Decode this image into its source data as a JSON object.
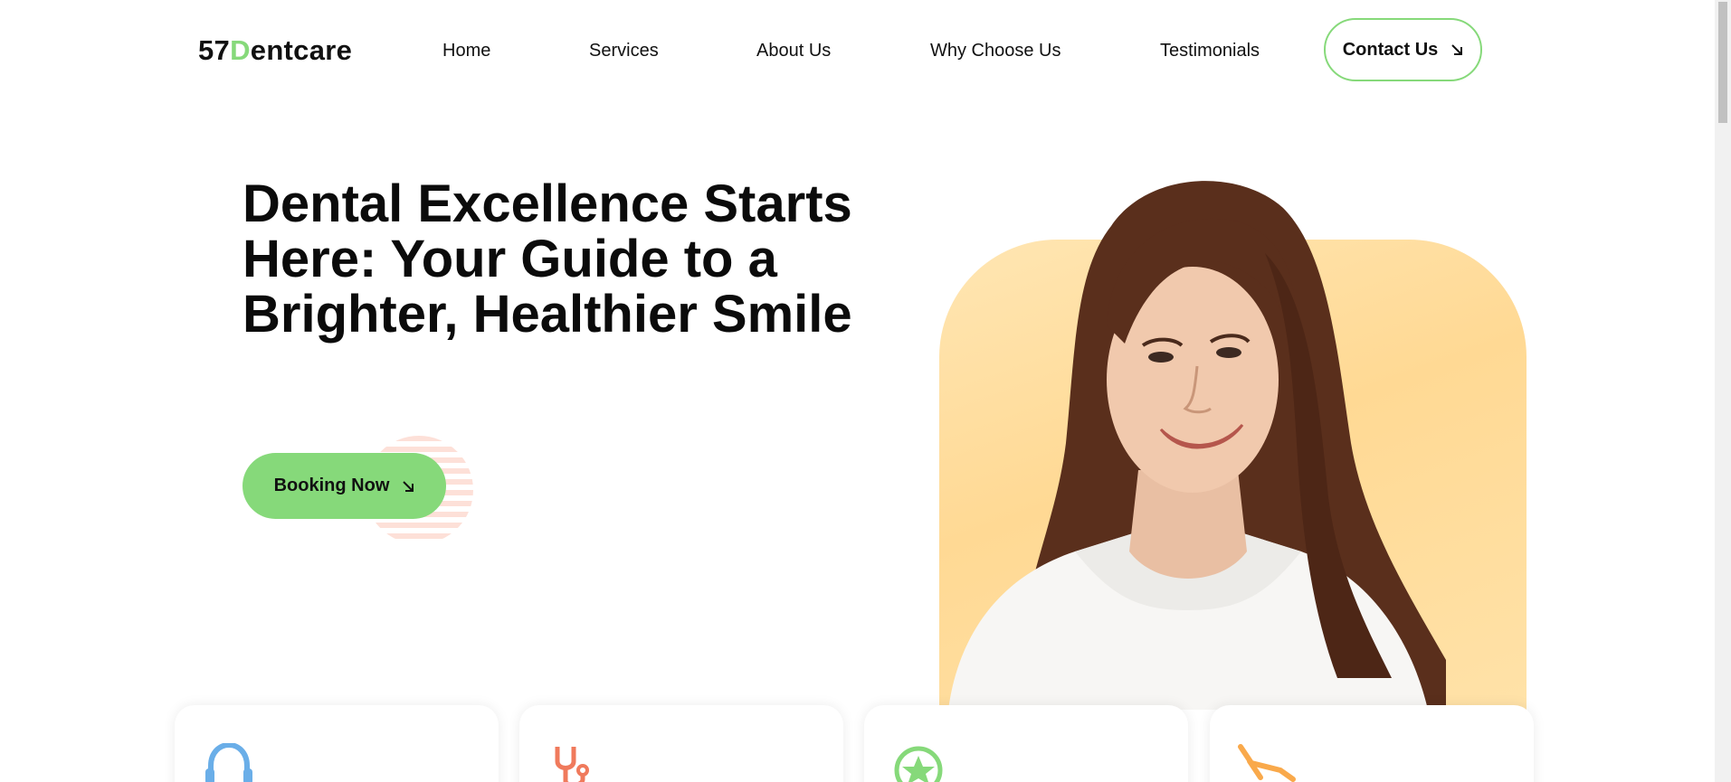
{
  "brand": {
    "logo_prefix": "57",
    "logo_accent": "D",
    "logo_suffix": "entcare",
    "accent_color": "#86d97a"
  },
  "nav": {
    "items": [
      {
        "label": "Home"
      },
      {
        "label": "Services"
      },
      {
        "label": "About Us"
      },
      {
        "label": "Why Choose Us"
      },
      {
        "label": "Testimonials"
      }
    ],
    "contact_label": "Contact Us",
    "contact_icon": "arrow-down-right-icon"
  },
  "hero": {
    "title": "Dental Excellence Starts Here: Your Guide to a Brighter, Healthier Smile",
    "button_label": "Booking Now",
    "button_icon": "arrow-down-right-icon",
    "image": "smiling-woman-portrait",
    "image_bg_color": "#ffd994"
  },
  "features": {
    "cards": [
      {
        "icon": "headset-support-icon",
        "color": "#6aaee8"
      },
      {
        "icon": "stethoscope-icon",
        "color": "#f07a5c"
      },
      {
        "icon": "star-badge-icon",
        "color": "#86d97a"
      },
      {
        "icon": "dental-chair-icon",
        "color": "#f9a94b"
      }
    ]
  }
}
